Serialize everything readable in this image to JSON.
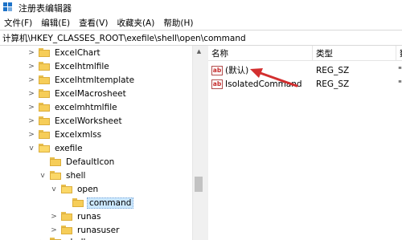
{
  "window": {
    "title": "注册表编辑器"
  },
  "menu": [
    "文件(F)",
    "编辑(E)",
    "查看(V)",
    "收藏夹(A)",
    "帮助(H)"
  ],
  "address": "计算机\\HKEY_CLASSES_ROOT\\exefile\\shell\\open\\command",
  "tree": {
    "items": [
      {
        "label": "ExcelChart",
        "expander": ">"
      },
      {
        "label": "Excelhtmlfile",
        "expander": ">"
      },
      {
        "label": "Excelhtmltemplate",
        "expander": ">"
      },
      {
        "label": "ExcelMacrosheet",
        "expander": ">"
      },
      {
        "label": "excelmhtmlfile",
        "expander": ">"
      },
      {
        "label": "ExcelWorksheet",
        "expander": ">"
      },
      {
        "label": "Excelxmlss",
        "expander": ">"
      },
      {
        "label": "exefile",
        "expander": "v"
      },
      {
        "label": "DefaultIcon",
        "expander": ""
      },
      {
        "label": "shell",
        "expander": "v"
      },
      {
        "label": "open",
        "expander": "v"
      },
      {
        "label": "command",
        "expander": ""
      },
      {
        "label": "runas",
        "expander": ">"
      },
      {
        "label": "runasuser",
        "expander": ">"
      },
      {
        "label": "shellex",
        "expander": ">"
      }
    ]
  },
  "list": {
    "columns": [
      "名称",
      "类型",
      "数"
    ],
    "rows": [
      {
        "name": "(默认)",
        "type": "REG_SZ",
        "data": "\""
      },
      {
        "name": "IsolatedCommand",
        "type": "REG_SZ",
        "data": "\""
      }
    ]
  },
  "icons": {
    "value_icon": "ab",
    "arrow_color": "#d32f2f",
    "selection_color": "#cce8ff",
    "app_icon_color": "#1e73c8"
  }
}
